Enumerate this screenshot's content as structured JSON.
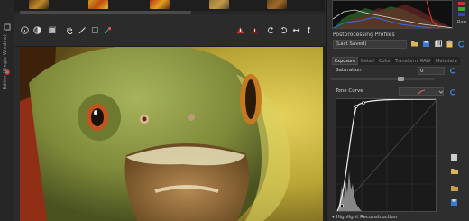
{
  "left_strip": {
    "vertical_label": "Editor (Single Window)"
  },
  "filmstrip": {
    "thumbnails": [
      {
        "color": "#8a5a1a"
      },
      {
        "color": "#c98a1b"
      },
      {
        "color": "#b4561a"
      },
      {
        "color": "#8c6a2a"
      },
      {
        "color": "#5a3a1a"
      }
    ]
  },
  "toolbar": {
    "icons": [
      "info-icon",
      "hand-icon",
      "pencil-icon",
      "crop-icon",
      "straighten-icon",
      "color-picker-icon",
      "warning-icon",
      "warning-red-icon",
      "rotate-left-icon",
      "rotate-right-icon",
      "flip-horizontal-icon",
      "flip-vertical-icon"
    ]
  },
  "histogram": {
    "raw_label": "Raw"
  },
  "processing_profiles": {
    "label": "Postprocessing Profiles",
    "selected": "(Last Saved)"
  },
  "tabs": [
    {
      "label": "Exposure",
      "active": true
    },
    {
      "label": "Detail",
      "active": false
    },
    {
      "label": "Color",
      "active": false
    },
    {
      "label": "Transform",
      "active": false
    },
    {
      "label": "RAW",
      "active": false
    },
    {
      "label": "Metadata",
      "active": false
    }
  ],
  "saturation": {
    "label": "Saturation",
    "value": "0",
    "level": 0.68
  },
  "tone_curve": {
    "label": "Tone Curve"
  },
  "highlight_section": {
    "label": "Highlight Reconstruction"
  },
  "colors": {
    "panel_bg": "#2e2e2e",
    "accent_blue": "#3a8ee6",
    "warning_red": "#d83a2a"
  }
}
